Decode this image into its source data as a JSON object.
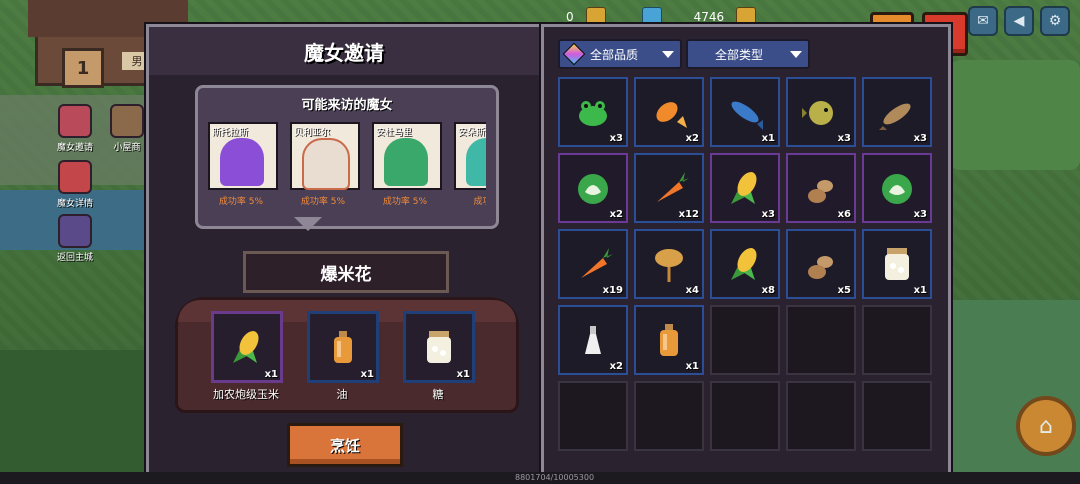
{
  "top": {
    "currency1": "0",
    "currency2": "4746"
  },
  "side_menu": [
    {
      "label": "魔女邀请",
      "icon": "heart-icon"
    },
    {
      "label": "小屋商",
      "icon": "shop-icon"
    },
    {
      "label": "魔女详情",
      "icon": "witch-detail-icon"
    },
    {
      "label": "返回主城",
      "icon": "return-icon"
    }
  ],
  "house": {
    "sign": "1",
    "tag": "男"
  },
  "left_panel": {
    "title": "魔女邀请",
    "visit_title": "可能来访的魔女",
    "witches": [
      {
        "name": "斯托拉斯",
        "rate": "成功率 5%",
        "color": "#8a4fd6"
      },
      {
        "name": "贝利亚尔",
        "rate": "成功率 5%",
        "color": "#e9dcd0"
      },
      {
        "name": "安杜马里",
        "rate": "成功率 5%",
        "color": "#3aa86b"
      },
      {
        "name": "安朵斯",
        "rate": "成功率",
        "color": "#3fb8a8"
      }
    ],
    "dish": "爆米花",
    "ingredients": [
      {
        "name": "加农炮级玉米",
        "count": "x1",
        "icon": "corn-icon"
      },
      {
        "name": "油",
        "count": "x1",
        "icon": "oil-bottle-icon"
      },
      {
        "name": "糖",
        "count": "x1",
        "icon": "sugar-jar-icon"
      }
    ],
    "cook_label": "烹饪"
  },
  "right_panel": {
    "filter_quality": "全部品质",
    "filter_type": "全部类型",
    "items": [
      {
        "icon": "frog-icon",
        "count": "x3",
        "border": "b"
      },
      {
        "icon": "goldfish-icon",
        "count": "x2",
        "border": "b"
      },
      {
        "icon": "blue-fish-icon",
        "count": "x1",
        "border": "b"
      },
      {
        "icon": "pufferfish-icon",
        "count": "x3",
        "border": "b"
      },
      {
        "icon": "brown-fish-icon",
        "count": "x3",
        "border": "b"
      },
      {
        "icon": "cabbage-icon",
        "count": "x2",
        "border": "p"
      },
      {
        "icon": "carrot-icon",
        "count": "x12",
        "border": "b"
      },
      {
        "icon": "corn-icon",
        "count": "x3",
        "border": "p"
      },
      {
        "icon": "potato-icon",
        "count": "x6",
        "border": "p"
      },
      {
        "icon": "cabbage-icon",
        "count": "x3",
        "border": "p"
      },
      {
        "icon": "carrot-icon",
        "count": "x19",
        "border": "b"
      },
      {
        "icon": "wheat-icon",
        "count": "x4",
        "border": "b"
      },
      {
        "icon": "corn-icon",
        "count": "x8",
        "border": "b"
      },
      {
        "icon": "potato-icon",
        "count": "x5",
        "border": "b"
      },
      {
        "icon": "sugar-jar-icon",
        "count": "x1",
        "border": "b"
      },
      {
        "icon": "flask-icon",
        "count": "x2",
        "border": "b"
      },
      {
        "icon": "oil-bottle-icon",
        "count": "x1",
        "border": "b"
      },
      {
        "icon": "",
        "count": "",
        "border": ""
      },
      {
        "icon": "",
        "count": "",
        "border": ""
      },
      {
        "icon": "",
        "count": "",
        "border": ""
      },
      {
        "icon": "",
        "count": "",
        "border": ""
      },
      {
        "icon": "",
        "count": "",
        "border": ""
      },
      {
        "icon": "",
        "count": "",
        "border": ""
      },
      {
        "icon": "",
        "count": "",
        "border": ""
      },
      {
        "icon": "",
        "count": "",
        "border": ""
      }
    ]
  },
  "bottom": {
    "text": "8801704/10005300"
  }
}
